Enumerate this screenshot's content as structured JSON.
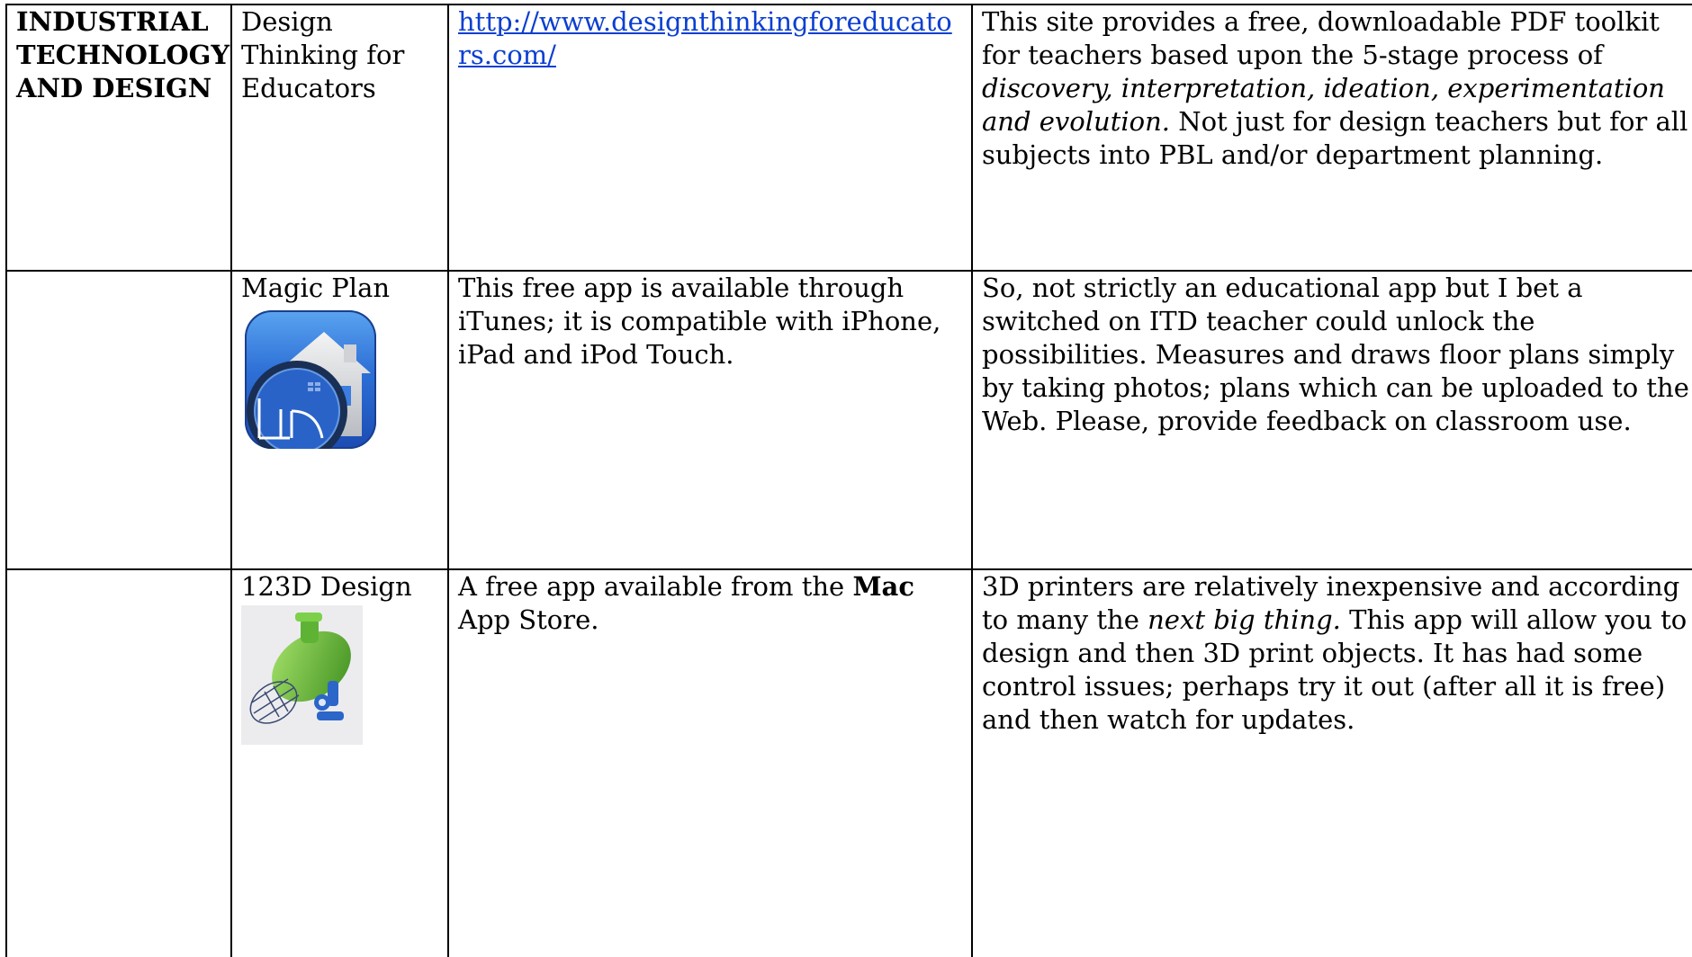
{
  "subject": {
    "line1": "INDUSTRIAL",
    "line2": "TECHNOLOGY",
    "line3": "AND DESIGN"
  },
  "rows": [
    {
      "app_name": "Design Thinking for Educators",
      "link_text": "http://www.designthinkingforeducators.com/",
      "description": {
        "part1": "This site provides a free, downloadable PDF toolkit for teachers based upon the 5-stage process of ",
        "part2_italic": "discovery, interpretation, ideation, experimentation and evolution.",
        "part3": " Not just for design teachers but for all subjects into PBL and/or department planning."
      }
    },
    {
      "app_name": "Magic Plan",
      "icon": "magic-plan-app-icon",
      "availability": "This free app is available through iTunes; it is compatible with iPhone, iPad and iPod Touch.",
      "description": "So, not strictly an educational app but I bet a switched on ITD teacher could unlock the possibilities. Measures and draws floor plans simply by taking photos; plans which can be uploaded to the Web. Please, provide feedback on classroom use."
    },
    {
      "app_name": "123D Design",
      "icon": "123d-design-submarine-icon",
      "availability": {
        "part1": "A free app available from the ",
        "part2_bold": "Mac",
        "part3": " App Store."
      },
      "description": {
        "part1": "3D printers are relatively inexpensive and according to many the ",
        "part2_italic": "next big thing.",
        "part3": " This app will allow you to design and then 3D print objects. It has had some control issues; perhaps try it out (after all it is free) and then watch for updates."
      }
    }
  ],
  "colors": {
    "link": "#0b3fd1",
    "magic_plan_blue": "#2d6fd6",
    "submarine_green": "#6cc23a"
  }
}
